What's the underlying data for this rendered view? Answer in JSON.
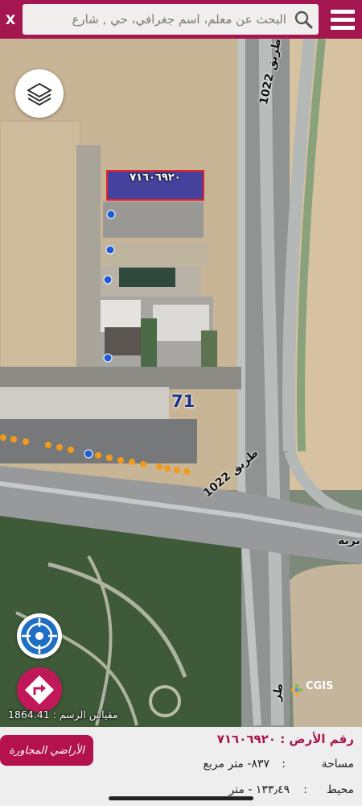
{
  "header": {
    "close_label": "X",
    "search_placeholder": "البحث عن معلم، اسم جغرافي، حي , شارع"
  },
  "map": {
    "parcel_label": "٧١٦٠٦٩٢٠",
    "road_number": "71",
    "road_label_1": "طريق 1022",
    "road_label_2": "طريق 1022",
    "road_label_3": "برية",
    "road_label_4": "طر",
    "scale_text": "مقياس الرسم : 1864.41",
    "logo_text": "CGIS"
  },
  "panel": {
    "neighbors_label": "الأراضي المجاورة",
    "land_number": "رقم الأرض : ٧١٦٠٦٩٢٠",
    "area_label": "مساحة",
    "area_value": "٨٣٧- متر مربع",
    "perimeter_label": "محيط",
    "perimeter_value": "١٣٣٫٤٩ - متر"
  },
  "colors": {
    "brand": "#a3164f",
    "parcel_fill": "#2e2ea0",
    "parcel_border": "#e8202a"
  }
}
